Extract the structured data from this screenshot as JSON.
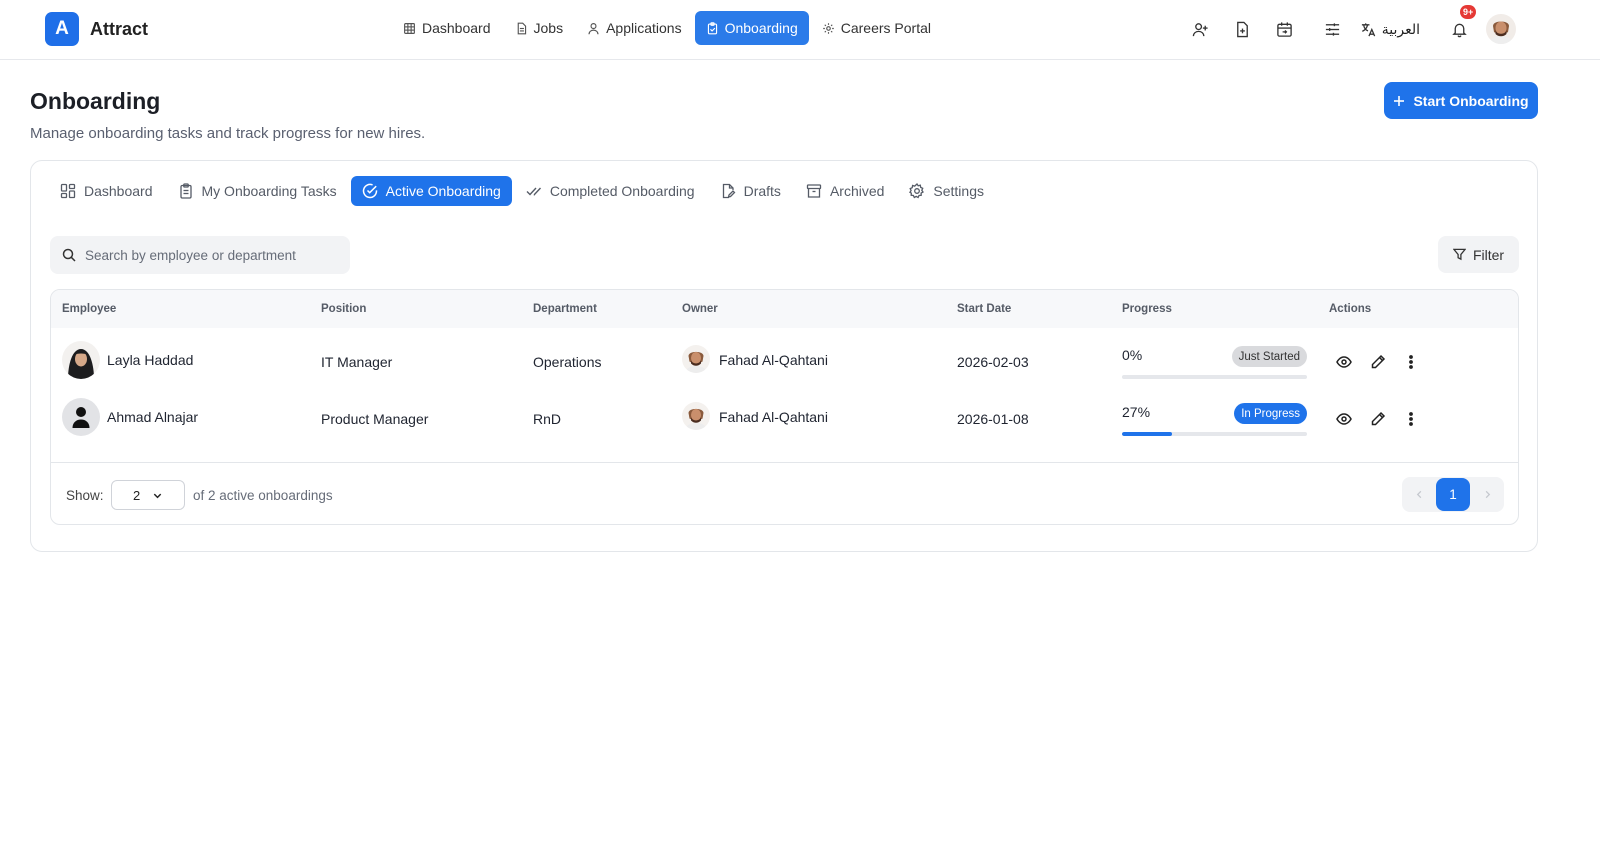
{
  "brand": {
    "logo_letter": "A",
    "name": "Attract"
  },
  "nav": {
    "items": [
      {
        "label": "Dashboard",
        "icon": "grid-icon"
      },
      {
        "label": "Jobs",
        "icon": "document-icon"
      },
      {
        "label": "Applications",
        "icon": "user-icon"
      },
      {
        "label": "Onboarding",
        "icon": "clipboard-icon",
        "active": true
      },
      {
        "label": "Careers Portal",
        "icon": "gear-icon"
      }
    ]
  },
  "top_actions": {
    "icons": [
      "user-plus-icon",
      "file-plus-icon",
      "calendar-icon",
      "sliders-icon"
    ],
    "language_label": "العربية",
    "notification_badge": "9+"
  },
  "page": {
    "title": "Onboarding",
    "subtitle": "Manage onboarding tasks and track progress for new hires.",
    "start_button": "Start Onboarding"
  },
  "tabs": [
    {
      "label": "Dashboard",
      "icon": "dashboard-icon"
    },
    {
      "label": "My Onboarding Tasks",
      "icon": "clipboard-list-icon"
    },
    {
      "label": "Active Onboarding",
      "icon": "check-circle-icon",
      "active": true
    },
    {
      "label": "Completed Onboarding",
      "icon": "double-check-icon"
    },
    {
      "label": "Drafts",
      "icon": "file-edit-icon"
    },
    {
      "label": "Archived",
      "icon": "archive-icon"
    },
    {
      "label": "Settings",
      "icon": "settings-icon"
    }
  ],
  "search": {
    "placeholder": "Search by employee or department"
  },
  "filter_label": "Filter",
  "table": {
    "columns": [
      "Employee",
      "Position",
      "Department",
      "Owner",
      "Start Date",
      "Progress",
      "Actions"
    ],
    "rows": [
      {
        "employee": "Layla Haddad",
        "position": "IT Manager",
        "department": "Operations",
        "owner": "Fahad Al-Qahtani",
        "start_date": "2026-02-03",
        "progress_text": "0%",
        "progress": 0,
        "status": "Just Started",
        "status_style": "gray"
      },
      {
        "employee": "Ahmad Alnajar",
        "position": "Product Manager",
        "department": "RnD",
        "owner": "Fahad Al-Qahtani",
        "start_date": "2026-01-08",
        "progress_text": "27%",
        "progress": 27,
        "status": "In Progress",
        "status_style": "blue"
      }
    ]
  },
  "footer": {
    "show_label": "Show:",
    "page_size": "2",
    "summary": "of 2 active onboardings",
    "current_page": "1"
  },
  "colors": {
    "accent": "#1f73ea",
    "badge_red": "#e53935"
  }
}
